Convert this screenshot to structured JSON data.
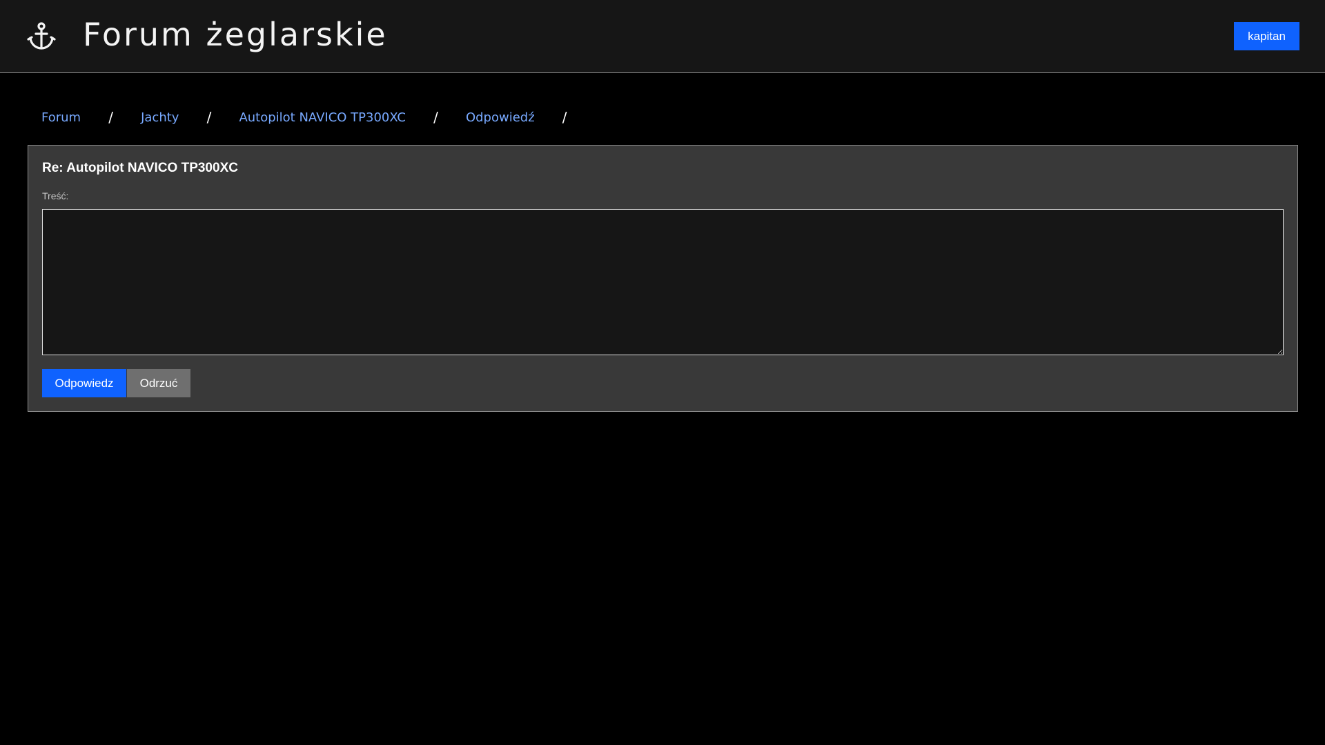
{
  "header": {
    "logo_icon": "anchor-icon",
    "title": "Forum żeglarskie",
    "user_button_label": "kapitan"
  },
  "breadcrumb": {
    "items": [
      "Forum",
      "Jachty",
      "Autopilot NAVICO TP300XC",
      "Odpowiedź"
    ],
    "separator": "/"
  },
  "reply_form": {
    "title": "Re: Autopilot NAVICO TP300XC",
    "content_label": "Treść:",
    "content_value": "",
    "submit_label": "Odpowiedz",
    "discard_label": "Odrzuć"
  },
  "colors": {
    "accent": "#0f62fe",
    "link": "#78a9ff",
    "header_bg": "#161616",
    "panel_bg": "#393939",
    "secondary_button": "#6f6f6f"
  }
}
